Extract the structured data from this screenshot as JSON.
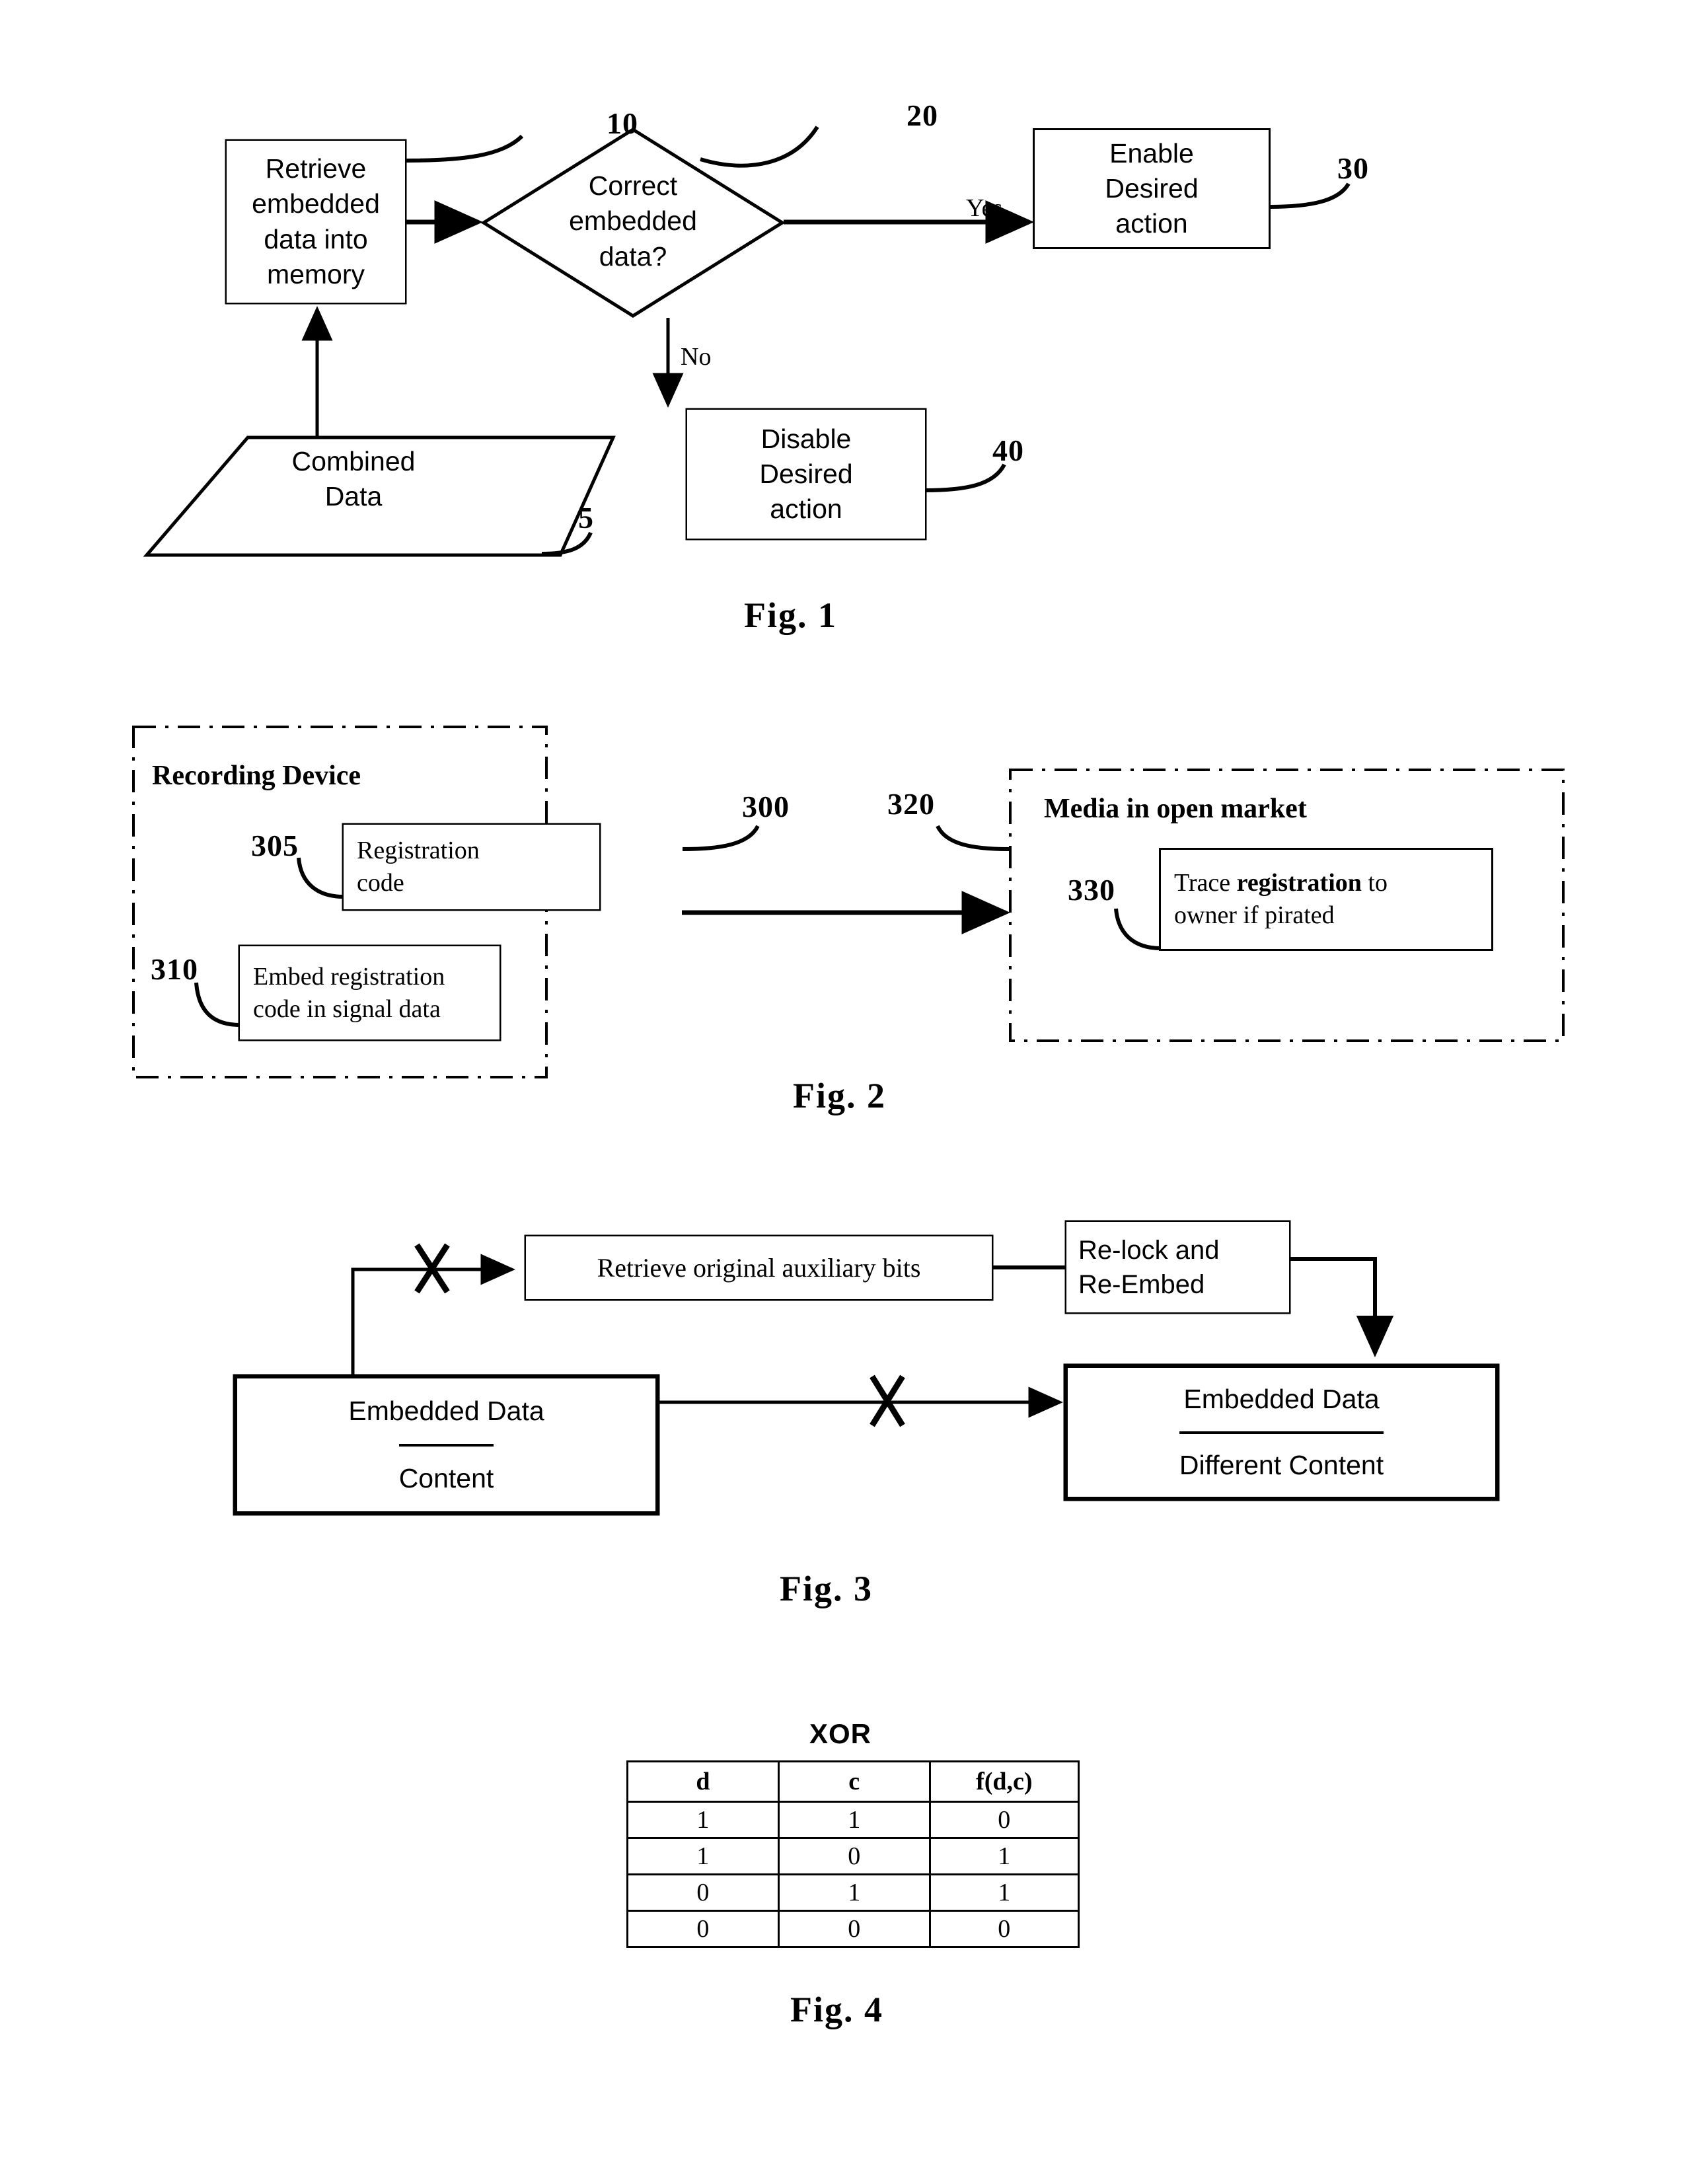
{
  "figures": [
    {
      "caption": "Fig. 1",
      "nodes": {
        "retrieve": "Retrieve\nembedded\ndata into\nmemory",
        "decision": "Correct\nembedded\ndata?",
        "enable": "Enable\nDesired\naction",
        "disable": "Disable\nDesired\naction",
        "combined": "Combined\nData"
      },
      "edge_labels": {
        "yes": "Yes",
        "no": "No"
      },
      "ref_numbers": {
        "retrieve": "10",
        "decision": "20",
        "enable": "30",
        "disable": "40",
        "combined": "5"
      }
    },
    {
      "caption": "Fig. 2",
      "groups": {
        "recording_device": "Recording Device",
        "media_open_market": "Media in open market"
      },
      "nodes": {
        "registration_code": "Registration\ncode",
        "embed_registration": "Embed registration\ncode in signal data",
        "trace_pre": "Trace ",
        "trace_bold": "registration",
        "trace_post": " to\nowner if pirated"
      },
      "ref_numbers": {
        "registration_code": "305",
        "embed_registration": "310",
        "arrow": "300",
        "media_open_market": "320",
        "trace": "330"
      }
    },
    {
      "caption": "Fig. 3",
      "nodes": {
        "retrieve_aux": "Retrieve original auxiliary bits",
        "relock": "Re-lock  and\nRe-Embed",
        "left_top": "Embedded Data",
        "left_bottom": "Content",
        "right_top": "Embedded Data",
        "right_bottom": "Different Content"
      },
      "markers": {
        "x1": "X",
        "x2": "X"
      }
    },
    {
      "caption": "Fig. 4",
      "title": "XOR"
    }
  ],
  "chart_data": {
    "type": "table",
    "title": "XOR",
    "columns": [
      "d",
      "c",
      "f(d,c)"
    ],
    "rows": [
      [
        "1",
        "1",
        "0"
      ],
      [
        "1",
        "0",
        "1"
      ],
      [
        "0",
        "1",
        "1"
      ],
      [
        "0",
        "0",
        "0"
      ]
    ]
  },
  "captions": {
    "fig1": "Fig. 1",
    "fig2": "Fig. 2",
    "fig3": "Fig. 3",
    "fig4": "Fig. 4"
  }
}
